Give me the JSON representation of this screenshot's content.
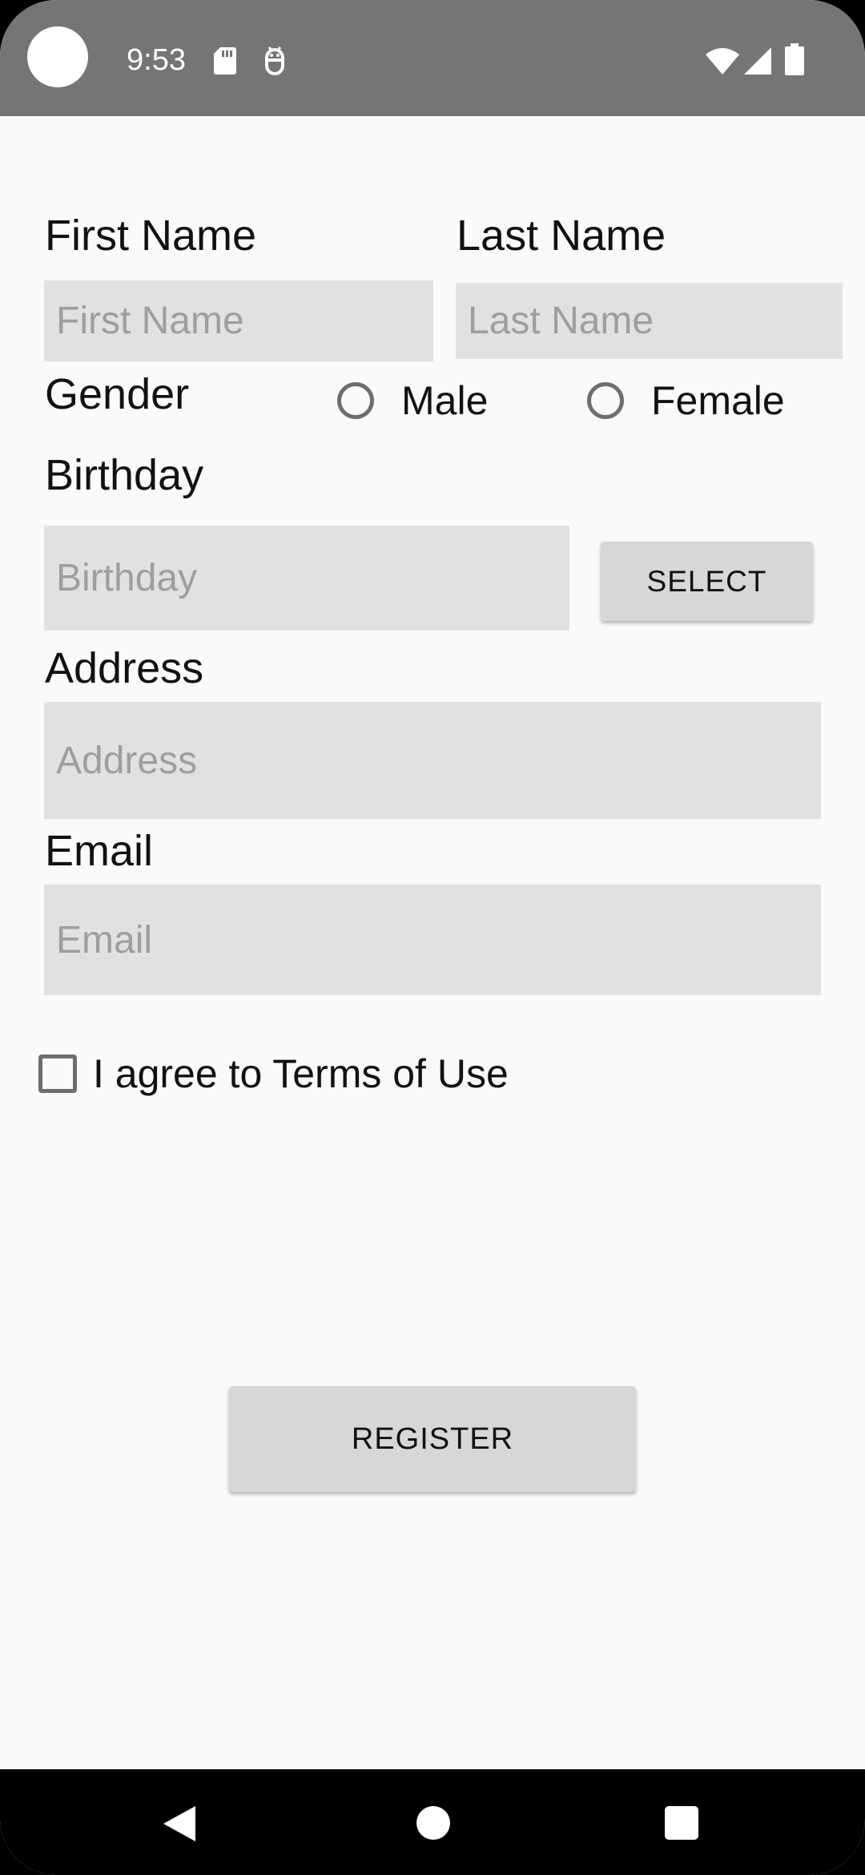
{
  "status_bar": {
    "time": "9:53",
    "icons": [
      "camera-cutout",
      "sd-card-icon",
      "android-debug-icon",
      "wifi-icon",
      "signal-icon",
      "battery-icon"
    ]
  },
  "form": {
    "first_name": {
      "label": "First Name",
      "placeholder": "First Name",
      "value": ""
    },
    "last_name": {
      "label": "Last Name",
      "placeholder": "Last Name",
      "value": ""
    },
    "gender": {
      "label": "Gender",
      "options": [
        "Male",
        "Female"
      ],
      "selected": null
    },
    "birthday": {
      "label": "Birthday",
      "placeholder": "Birthday",
      "value": "",
      "select_label": "SELECT"
    },
    "address": {
      "label": "Address",
      "placeholder": "Address",
      "value": ""
    },
    "email": {
      "label": "Email",
      "placeholder": "Email",
      "value": ""
    },
    "terms": {
      "label": "I agree to Terms of Use",
      "checked": false
    },
    "register_label": "REGISTER"
  },
  "nav_bar": {
    "buttons": [
      "back-icon",
      "home-icon",
      "recents-icon"
    ]
  },
  "colors": {
    "status_bar": "#757575",
    "background": "#fafafa",
    "input_fill": "#e1e1e1",
    "button_fill": "#d6d7d7",
    "nav_bar": "#000000"
  }
}
